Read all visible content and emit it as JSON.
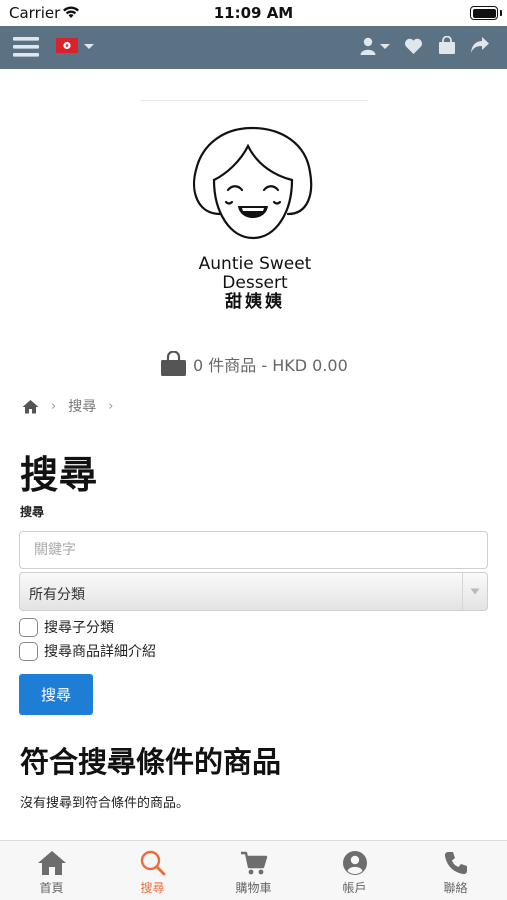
{
  "status_bar": {
    "carrier": "Carrier",
    "time": "11:09 AM"
  },
  "navbar": {
    "icons": [
      "menu-icon",
      "hk-flag-icon",
      "user-icon",
      "heart-icon",
      "bag-icon",
      "share-icon"
    ]
  },
  "logo": {
    "line1": "Auntie Sweet",
    "line2": "Dessert",
    "line3": "甜姨姨"
  },
  "cart": {
    "summary": "0 件商品 - HKD 0.00"
  },
  "breadcrumb": {
    "current": "搜尋"
  },
  "page": {
    "title": "搜尋",
    "search_label": "搜尋",
    "search_placeholder": "關鍵字",
    "search_value": "",
    "category_selected": "所有分類",
    "checkbox_subcategories": "搜尋子分類",
    "checkbox_description": "搜尋商品詳細介紹",
    "search_button": "搜尋",
    "results_title": "符合搜尋條件的商品",
    "no_results": "沒有搜尋到符合條件的商品。"
  },
  "tabbar": {
    "items": [
      {
        "label": "首頁",
        "icon": "home-icon"
      },
      {
        "label": "搜尋",
        "icon": "search-icon"
      },
      {
        "label": "購物車",
        "icon": "cart-icon"
      },
      {
        "label": "帳戶",
        "icon": "account-icon"
      },
      {
        "label": "聯絡",
        "icon": "phone-icon"
      }
    ],
    "active_index": 1
  },
  "colors": {
    "navbar": "#5a7284",
    "primary_button": "#1e7ed6",
    "active_tab": "#f06a3a"
  }
}
